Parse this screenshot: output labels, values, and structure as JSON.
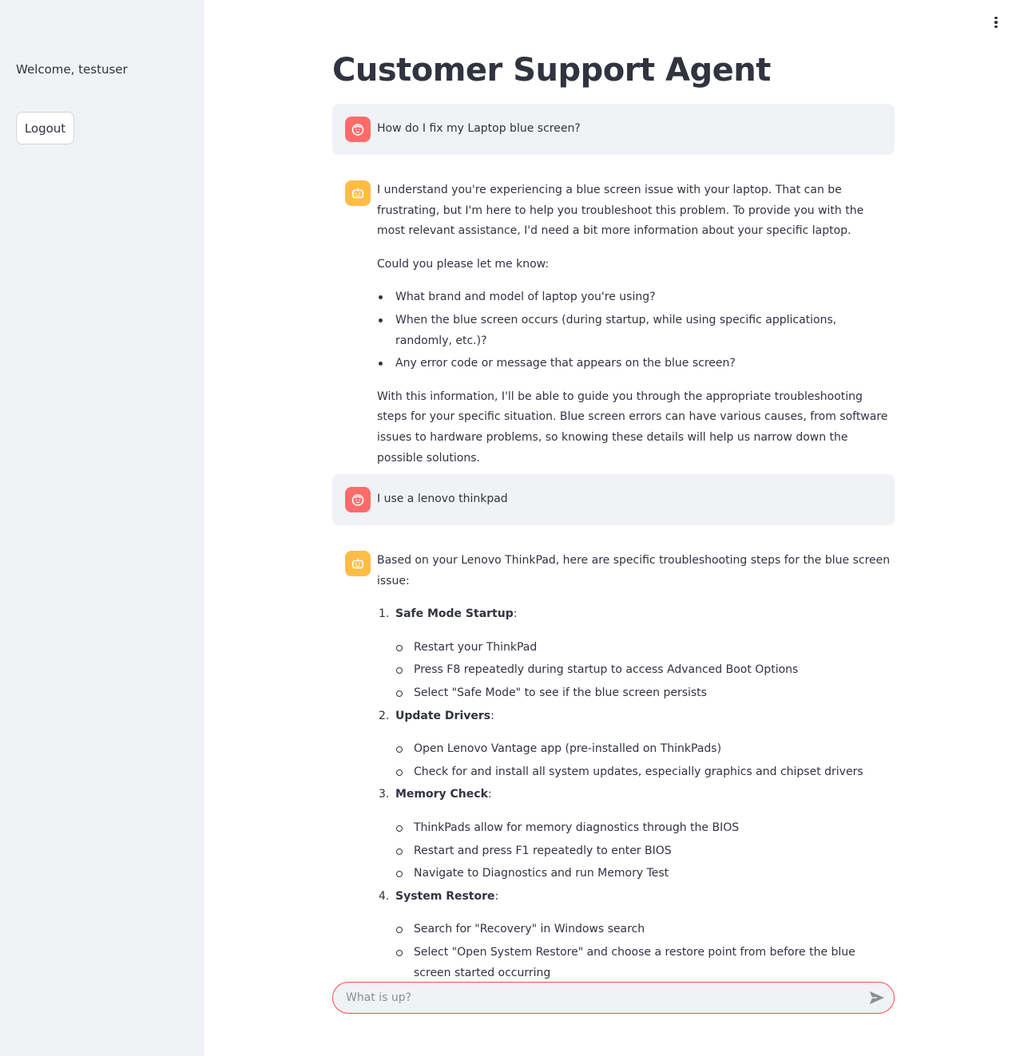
{
  "sidebar": {
    "welcome_text": "Welcome, testuser",
    "logout_label": "Logout"
  },
  "menu": {
    "icon": "kebab-menu-icon"
  },
  "page": {
    "title": "Customer Support Agent"
  },
  "messages": [
    {
      "role": "user",
      "avatar": "user-face-icon",
      "text": "How do I fix my Laptop blue screen?"
    },
    {
      "role": "assistant",
      "avatar": "robot-icon",
      "paragraphs": [
        "I understand you're experiencing a blue screen issue with your laptop. That can be frustrating, but I'm here to help you troubleshoot this problem. To provide you with the most relevant assistance, I'd need a bit more information about your specific laptop.",
        "Could you please let me know:"
      ],
      "bullets": [
        "What brand and model of laptop you're using?",
        "When the blue screen occurs (during startup, while using specific applications, randomly, etc.)?",
        "Any error code or message that appears on the blue screen?"
      ],
      "closing": "With this information, I'll be able to guide you through the appropriate troubleshooting steps for your specific situation. Blue screen errors can have various causes, from software issues to hardware problems, so knowing these details will help us narrow down the possible solutions."
    },
    {
      "role": "user",
      "avatar": "user-face-icon",
      "text": "I use a lenovo thinkpad"
    },
    {
      "role": "assistant",
      "avatar": "robot-icon",
      "intro": "Based on your Lenovo ThinkPad, here are specific troubleshooting steps for the blue screen issue:",
      "steps": [
        {
          "num": "1.",
          "title": "Safe Mode Startup",
          "items": [
            "Restart your ThinkPad",
            "Press F8 repeatedly during startup to access Advanced Boot Options",
            "Select \"Safe Mode\" to see if the blue screen persists"
          ]
        },
        {
          "num": "2.",
          "title": "Update Drivers",
          "items": [
            "Open Lenovo Vantage app (pre-installed on ThinkPads)",
            "Check for and install all system updates, especially graphics and chipset drivers"
          ]
        },
        {
          "num": "3.",
          "title": "Memory Check",
          "items": [
            "ThinkPads allow for memory diagnostics through the BIOS",
            "Restart and press F1 repeatedly to enter BIOS",
            "Navigate to Diagnostics and run Memory Test"
          ]
        },
        {
          "num": "4.",
          "title": "System Restore",
          "items": [
            "Search for \"Recovery\" in Windows search",
            "Select \"Open System Restore\" and choose a restore point from before the blue screen started occurring"
          ]
        }
      ]
    }
  ],
  "chat_input": {
    "placeholder": "What is up?",
    "value": "",
    "send_icon": "send-icon"
  },
  "colors": {
    "accent": "#ff4b4b",
    "user_avatar": "#ff6b6b",
    "bot_avatar": "#ffbd45",
    "sidebar_bg": "#f0f2f6"
  }
}
